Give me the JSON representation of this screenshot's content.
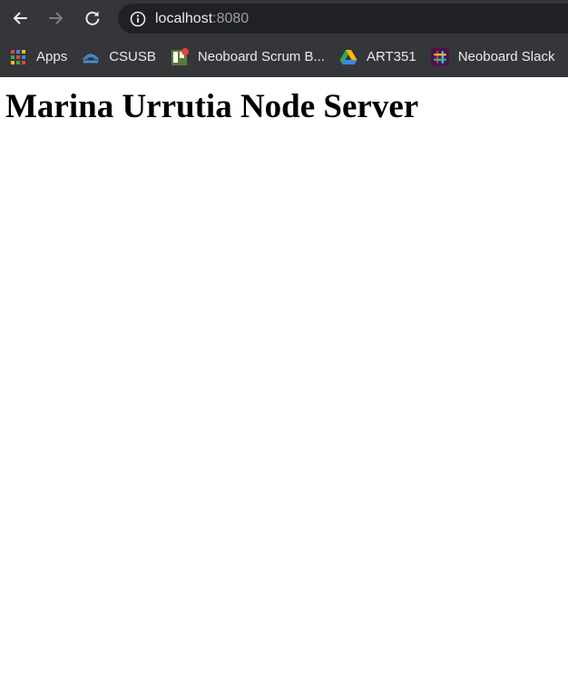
{
  "browser": {
    "address_bar": {
      "host": "localhost",
      "port": ":8080"
    },
    "bookmarks": [
      {
        "label": "Apps",
        "icon": "apps-grid-icon"
      },
      {
        "label": "CSUSB",
        "icon": "csusb-logo-icon"
      },
      {
        "label": "Neoboard Scrum B...",
        "icon": "trello-icon"
      },
      {
        "label": "ART351",
        "icon": "google-drive-icon"
      },
      {
        "label": "Neoboard Slack",
        "icon": "slack-icon"
      }
    ]
  },
  "page": {
    "heading": "Marina Urrutia Node Server"
  },
  "colors": {
    "toolbar_bg": "#35363a",
    "omnibox_bg": "#202124",
    "text_light": "#e8eaed",
    "text_dim": "#9aa0a6"
  }
}
